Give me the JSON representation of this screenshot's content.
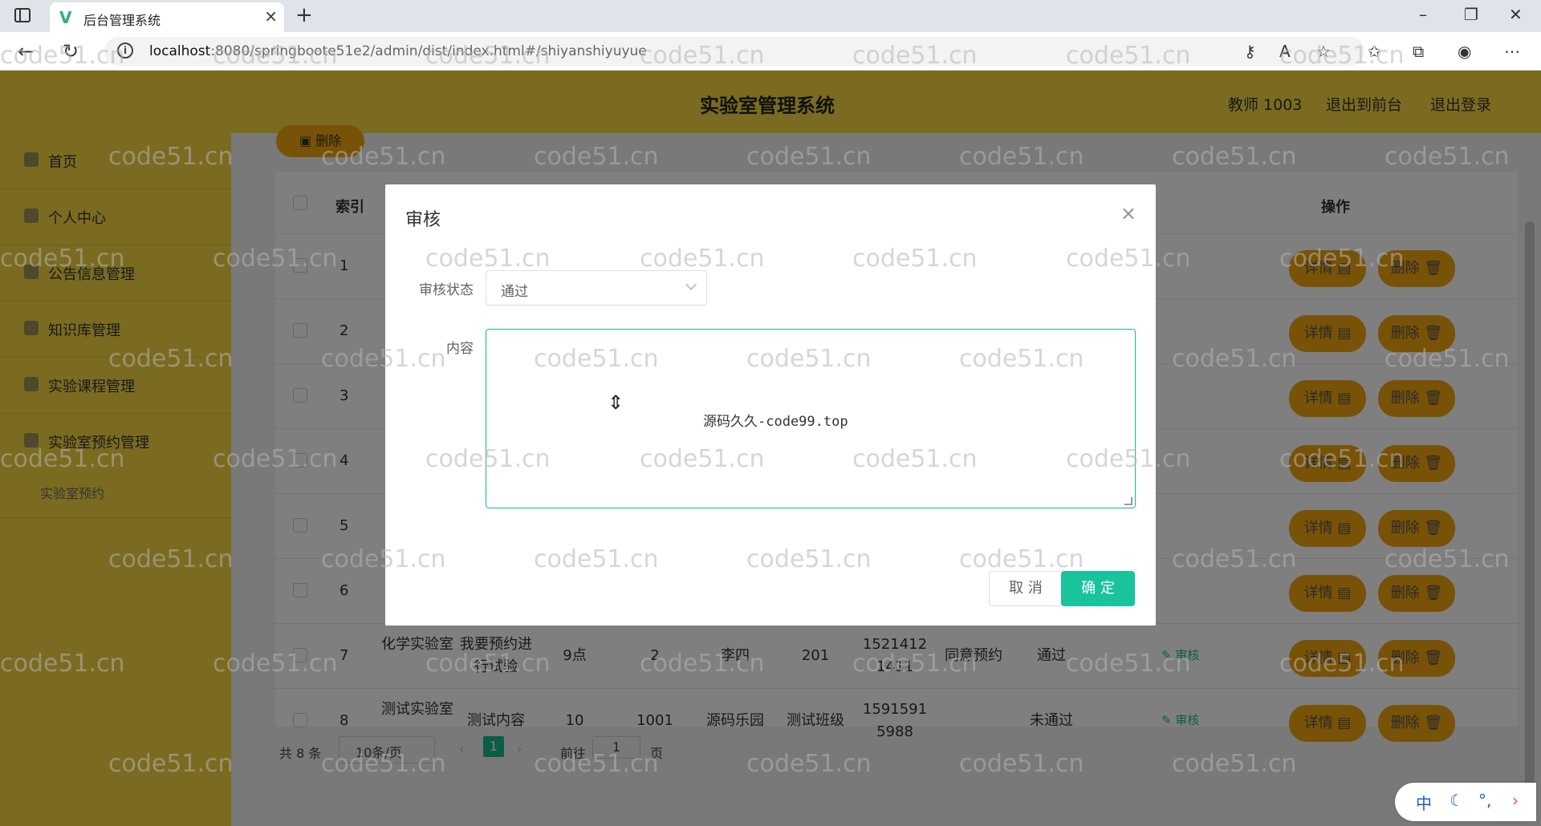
{
  "browser": {
    "tab_title": "后台管理系统",
    "url_host": "localhost",
    "url_rest": ":8080/springboote51e2/admin/dist/index.html#/shiyanshiyuyue"
  },
  "header": {
    "title": "实验室管理系统",
    "user": "教师 1003",
    "back_front": "退出到前台",
    "logout": "退出登录"
  },
  "sidebar": {
    "items": [
      {
        "label": "首页"
      },
      {
        "label": "个人中心"
      },
      {
        "label": "公告信息管理"
      },
      {
        "label": "知识库管理"
      },
      {
        "label": "实验课程管理"
      },
      {
        "label": "实验室预约管理"
      }
    ],
    "sub_item": "实验室预约"
  },
  "toolbar": {
    "delete_label": "删除"
  },
  "table": {
    "headers": {
      "index": "索引",
      "actions": "操作"
    },
    "detail_label": "详情",
    "delete_label": "删除",
    "audit_label": "审核",
    "rows": [
      {
        "index": "1"
      },
      {
        "index": "2"
      },
      {
        "index": "3"
      },
      {
        "index": "4"
      },
      {
        "index": "5"
      },
      {
        "index": "6"
      },
      {
        "index": "7",
        "lab": "化学实验室",
        "content": "我要预约进行试验",
        "time": "9点",
        "num": "2",
        "name": "李四",
        "cls": "201",
        "phone": "15214121411",
        "reply": "同意预约",
        "status": "通过"
      },
      {
        "index": "8",
        "lab": "测试实验室",
        "content": "测试内容",
        "time": "10",
        "num": "1001",
        "name": "源码乐园",
        "cls": "测试班级",
        "phone": "15915915988",
        "reply": "",
        "status": "未通过"
      }
    ]
  },
  "pagination": {
    "total": "共 8 条",
    "page_size": "10条/页",
    "current": "1",
    "goto_prefix": "前往",
    "goto_value": "1",
    "goto_suffix": "页"
  },
  "dialog": {
    "title": "审核",
    "status_label": "审核状态",
    "status_value": "通过",
    "content_label": "内容",
    "content_value": "源码久久-code99.top",
    "cancel_label": "取 消",
    "ok_label": "确 定"
  },
  "ime": {
    "lang": "中"
  },
  "watermark": "code51.cn",
  "colors": {
    "header_bg": "#f5d742",
    "accent": "#19c39b",
    "button": "#f0a40f"
  }
}
